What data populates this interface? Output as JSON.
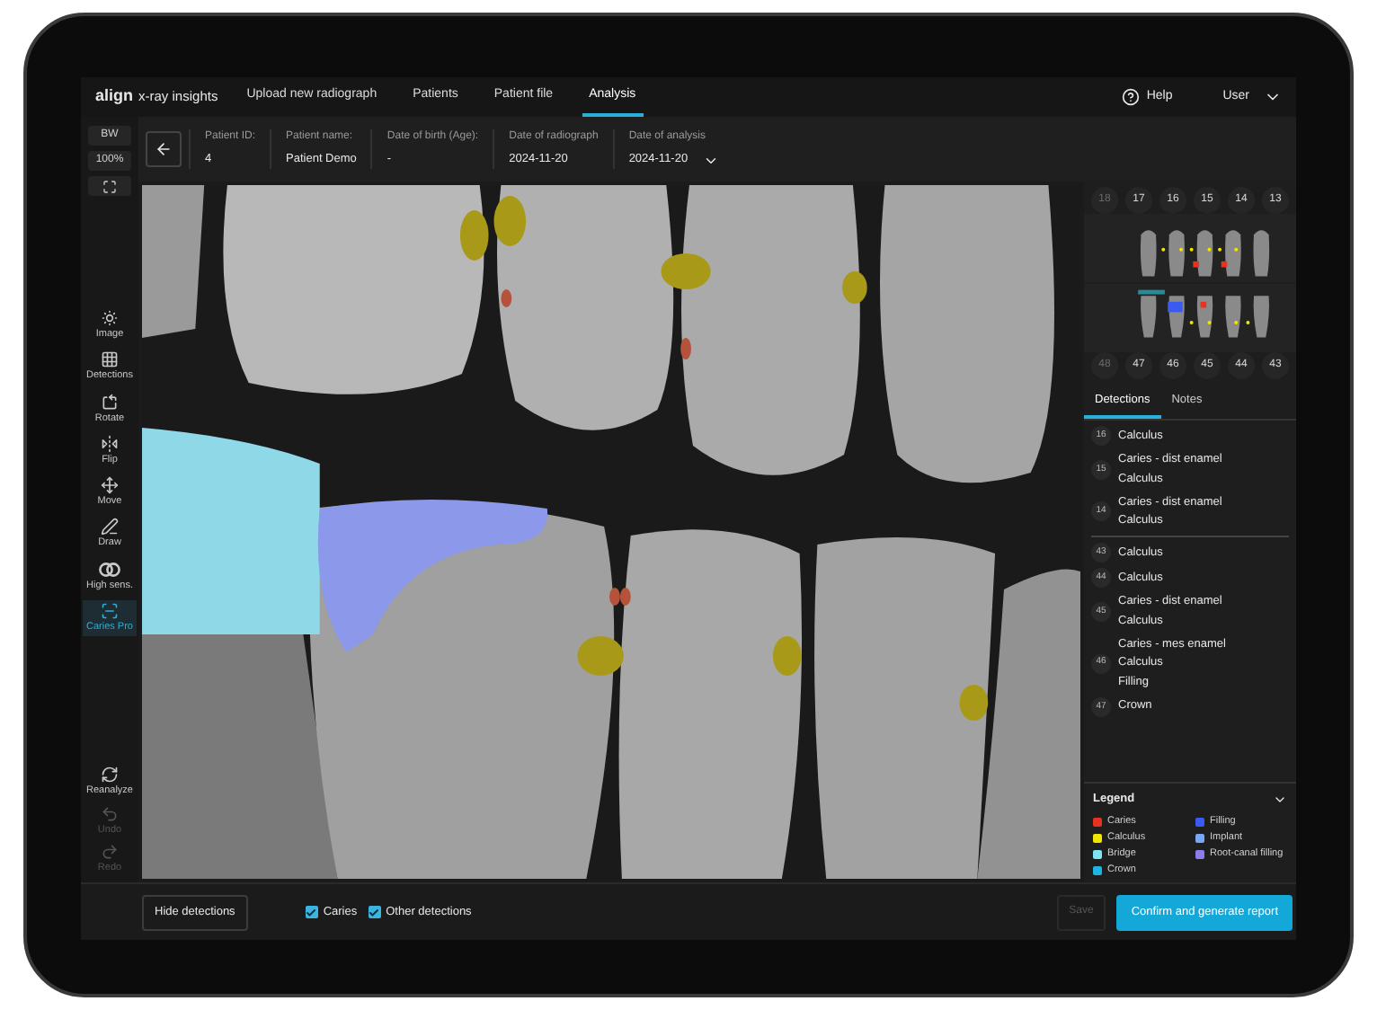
{
  "brand": {
    "logo": "align",
    "product": "x-ray insights"
  },
  "nav": [
    {
      "label": "Upload new radiograph",
      "selected": false
    },
    {
      "label": "Patients",
      "selected": false
    },
    {
      "label": "Patient file",
      "selected": false
    },
    {
      "label": "Analysis",
      "selected": true
    }
  ],
  "help": "Help",
  "user": "User",
  "patient_fields": [
    {
      "label": "Patient ID:",
      "value": "4"
    },
    {
      "label": "Patient name:",
      "value": "Patient Demo"
    },
    {
      "label": "Date of birth (Age):",
      "value": "-"
    },
    {
      "label": "Date of radiograph",
      "value": "2024-11-20"
    },
    {
      "label": "Date of analysis",
      "value": "2024-11-20",
      "dropdown": true
    }
  ],
  "view_buttons": [
    "BW",
    "100%"
  ],
  "tools": [
    {
      "label": "Image",
      "selected": false
    },
    {
      "label": "Detections",
      "selected": false
    },
    {
      "label": "Rotate",
      "selected": false
    },
    {
      "label": "Flip",
      "selected": false
    },
    {
      "label": "Move",
      "selected": false
    },
    {
      "label": "Draw",
      "selected": false
    },
    {
      "label": "High sens.",
      "selected": false
    },
    {
      "label": "Caries Pro",
      "selected": true
    }
  ],
  "bottom_tools": [
    {
      "label": "Reanalyze",
      "disabled": false
    },
    {
      "label": "Undo",
      "disabled": true
    },
    {
      "label": "Redo",
      "disabled": true
    }
  ],
  "tooth_chart": {
    "upper": [
      {
        "number": "18",
        "present": false
      },
      {
        "number": "17",
        "present": true
      },
      {
        "number": "16",
        "present": true
      },
      {
        "number": "15",
        "present": true
      },
      {
        "number": "14",
        "present": true
      },
      {
        "number": "13",
        "present": true
      }
    ],
    "lower": [
      {
        "number": "48",
        "present": false
      },
      {
        "number": "47",
        "present": true
      },
      {
        "number": "46",
        "present": true
      },
      {
        "number": "45",
        "present": true
      },
      {
        "number": "44",
        "present": true
      },
      {
        "number": "43",
        "present": true
      }
    ]
  },
  "panel_tabs": [
    {
      "label": "Detections",
      "selected": true
    },
    {
      "label": "Notes",
      "selected": false
    }
  ],
  "detection_groups": [
    [
      {
        "tooth": "16",
        "findings": [
          "Calculus"
        ]
      },
      {
        "tooth": "15",
        "findings": [
          "Caries - dist enamel",
          "Calculus"
        ]
      },
      {
        "tooth": "14",
        "findings": [
          "Caries - dist enamel",
          "Calculus"
        ]
      }
    ],
    [
      {
        "tooth": "43",
        "findings": [
          "Calculus"
        ]
      },
      {
        "tooth": "44",
        "findings": [
          "Calculus"
        ]
      },
      {
        "tooth": "45",
        "findings": [
          "Caries - dist enamel",
          "Calculus"
        ]
      },
      {
        "tooth": "46",
        "findings": [
          "Caries - mes enamel",
          "Calculus",
          "Filling"
        ]
      },
      {
        "tooth": "47",
        "findings": [
          "Crown"
        ]
      }
    ]
  ],
  "legend": {
    "title": "Legend",
    "expanded": true,
    "items": [
      {
        "label": "Caries",
        "color": "#e8321e"
      },
      {
        "label": "Filling",
        "color": "#3b5bf0"
      },
      {
        "label": "Calculus",
        "color": "#f2e600"
      },
      {
        "label": "Implant",
        "color": "#7aa7f5"
      },
      {
        "label": "Bridge",
        "color": "#7fe3f2"
      },
      {
        "label": "Root-canal filling",
        "color": "#8b7cf0"
      },
      {
        "label": "Crown",
        "color": "#1fb3e0"
      }
    ]
  },
  "hide_button": "Hide detections",
  "filters": [
    {
      "label": "Caries",
      "checked": true
    },
    {
      "label": "Other detections",
      "checked": true
    }
  ],
  "save": {
    "label": "Save",
    "disabled": true
  },
  "confirm": "Confirm and generate report"
}
